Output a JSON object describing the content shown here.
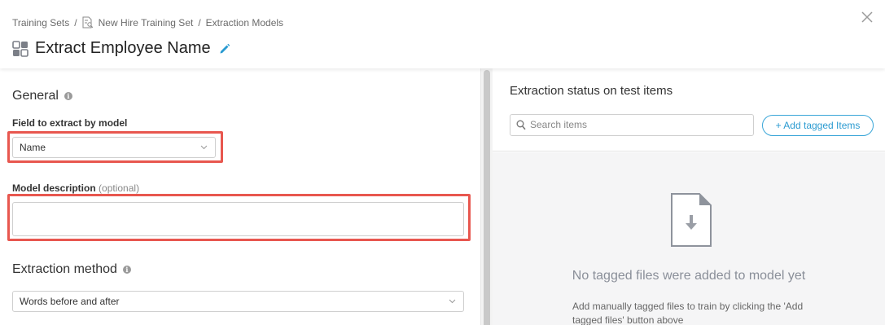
{
  "breadcrumb": {
    "items": [
      "Training Sets",
      "New Hire Training Set",
      "Extraction Models"
    ],
    "separator": "/"
  },
  "page_title": "Extract Employee Name",
  "general": {
    "title": "General",
    "field_label": "Field to extract by model",
    "field_value": "Name",
    "desc_label": "Model description",
    "desc_optional": "(optional)",
    "desc_value": ""
  },
  "extraction_method": {
    "title": "Extraction method",
    "value": "Words before and after"
  },
  "right_panel": {
    "title": "Extraction status on test items",
    "search_placeholder": "Search items",
    "add_button": "+ Add tagged Items",
    "empty_title": "No tagged files were added to model yet",
    "empty_desc": "Add manually tagged files to train by clicking the 'Add tagged files' button above"
  },
  "colors": {
    "accent": "#2b9bd1",
    "highlight": "#e8574f"
  },
  "icons": [
    "doc-search-icon",
    "close-icon",
    "model-icon",
    "pencil-icon",
    "info-icon",
    "chevron-down-icon",
    "search-icon",
    "file-download-icon"
  ]
}
